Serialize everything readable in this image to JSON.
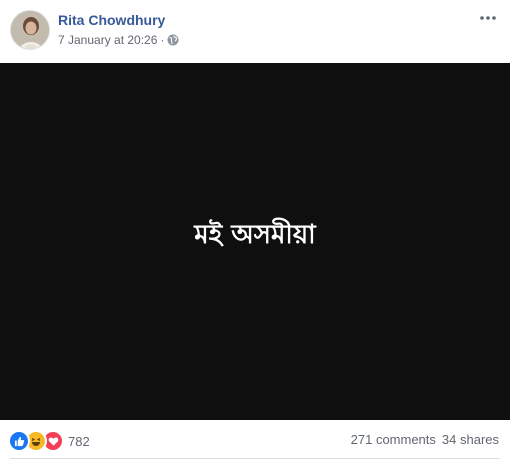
{
  "post": {
    "author": "Rita Chowdhury",
    "timestamp": "7 January at 20:26",
    "separator": "·",
    "privacy_icon": "globe-icon",
    "more_icon": "more-horizontal-icon",
    "media_text": "মই অসমীয়া",
    "media_background": "#0f0f0f"
  },
  "footer": {
    "reaction_icons": [
      "like-icon",
      "haha-icon",
      "love-icon"
    ],
    "reaction_count": "782",
    "comments": "271 comments",
    "shares": "34 shares"
  },
  "colors": {
    "author_link": "#385898",
    "meta_text": "#616770",
    "like": "#1877f2",
    "haha": "#f7b928",
    "love": "#f33e58"
  }
}
